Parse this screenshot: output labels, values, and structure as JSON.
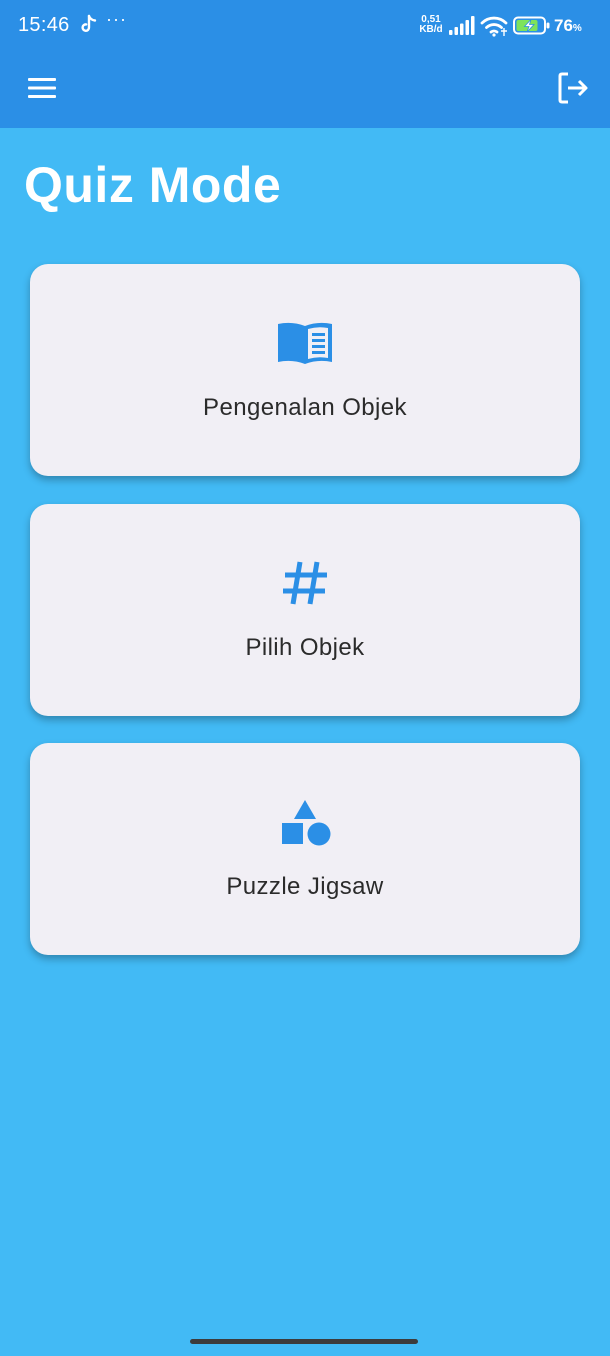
{
  "status_bar": {
    "time": "15:46",
    "dots": "···",
    "speed_value": "0,51",
    "speed_unit": "KB/d",
    "battery_percent": "76",
    "battery_unit": "%"
  },
  "app_bar": {
    "menu_icon": "menu-icon",
    "logout_icon": "logout-icon"
  },
  "page": {
    "title": "Quiz Mode"
  },
  "cards": [
    {
      "label": "Pengenalan Objek",
      "icon": "book-icon"
    },
    {
      "label": "Pilih Objek",
      "icon": "hash-icon"
    },
    {
      "label": "Puzzle Jigsaw",
      "icon": "shapes-icon"
    }
  ],
  "colors": {
    "background": "#42baf5",
    "app_bar": "#2b8fe6",
    "card": "#f1eff5",
    "accent": "#2b8fe6"
  }
}
